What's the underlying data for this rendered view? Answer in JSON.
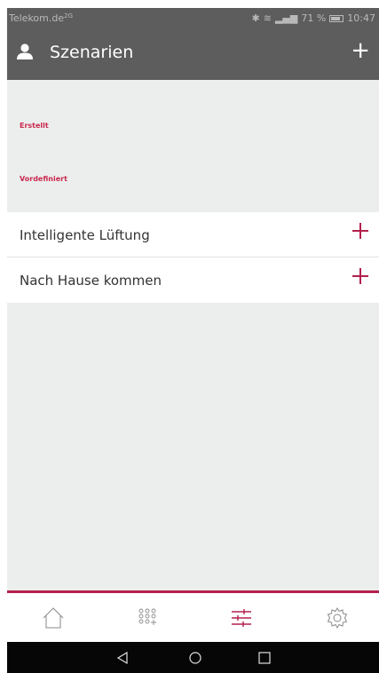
{
  "status_bar": {
    "carrier": "Telekom.de",
    "carrier_suffix": "2G",
    "battery": "71 %",
    "time": "10:47"
  },
  "app_bar": {
    "title": "Szenarien"
  },
  "sections": {
    "created": "Erstellt",
    "predefined": "Vordefiniert"
  },
  "predefined_scenarios": [
    {
      "label": "Intelligente Lüftung"
    },
    {
      "label": "Nach Hause kommen"
    }
  ],
  "colors": {
    "accent": "#b3204d",
    "app_bar_bg": "#5d5d5d",
    "content_bg": "#eceeed",
    "section_label": "#c9294f"
  },
  "tabs": [
    {
      "icon": "home-icon",
      "active": false
    },
    {
      "icon": "devices-grid-icon",
      "active": false
    },
    {
      "icon": "scenarios-sliders-icon",
      "active": true
    },
    {
      "icon": "settings-gear-icon",
      "active": false
    }
  ],
  "system_nav": [
    {
      "icon": "back-triangle-icon"
    },
    {
      "icon": "home-circle-icon"
    },
    {
      "icon": "recents-square-icon"
    }
  ]
}
